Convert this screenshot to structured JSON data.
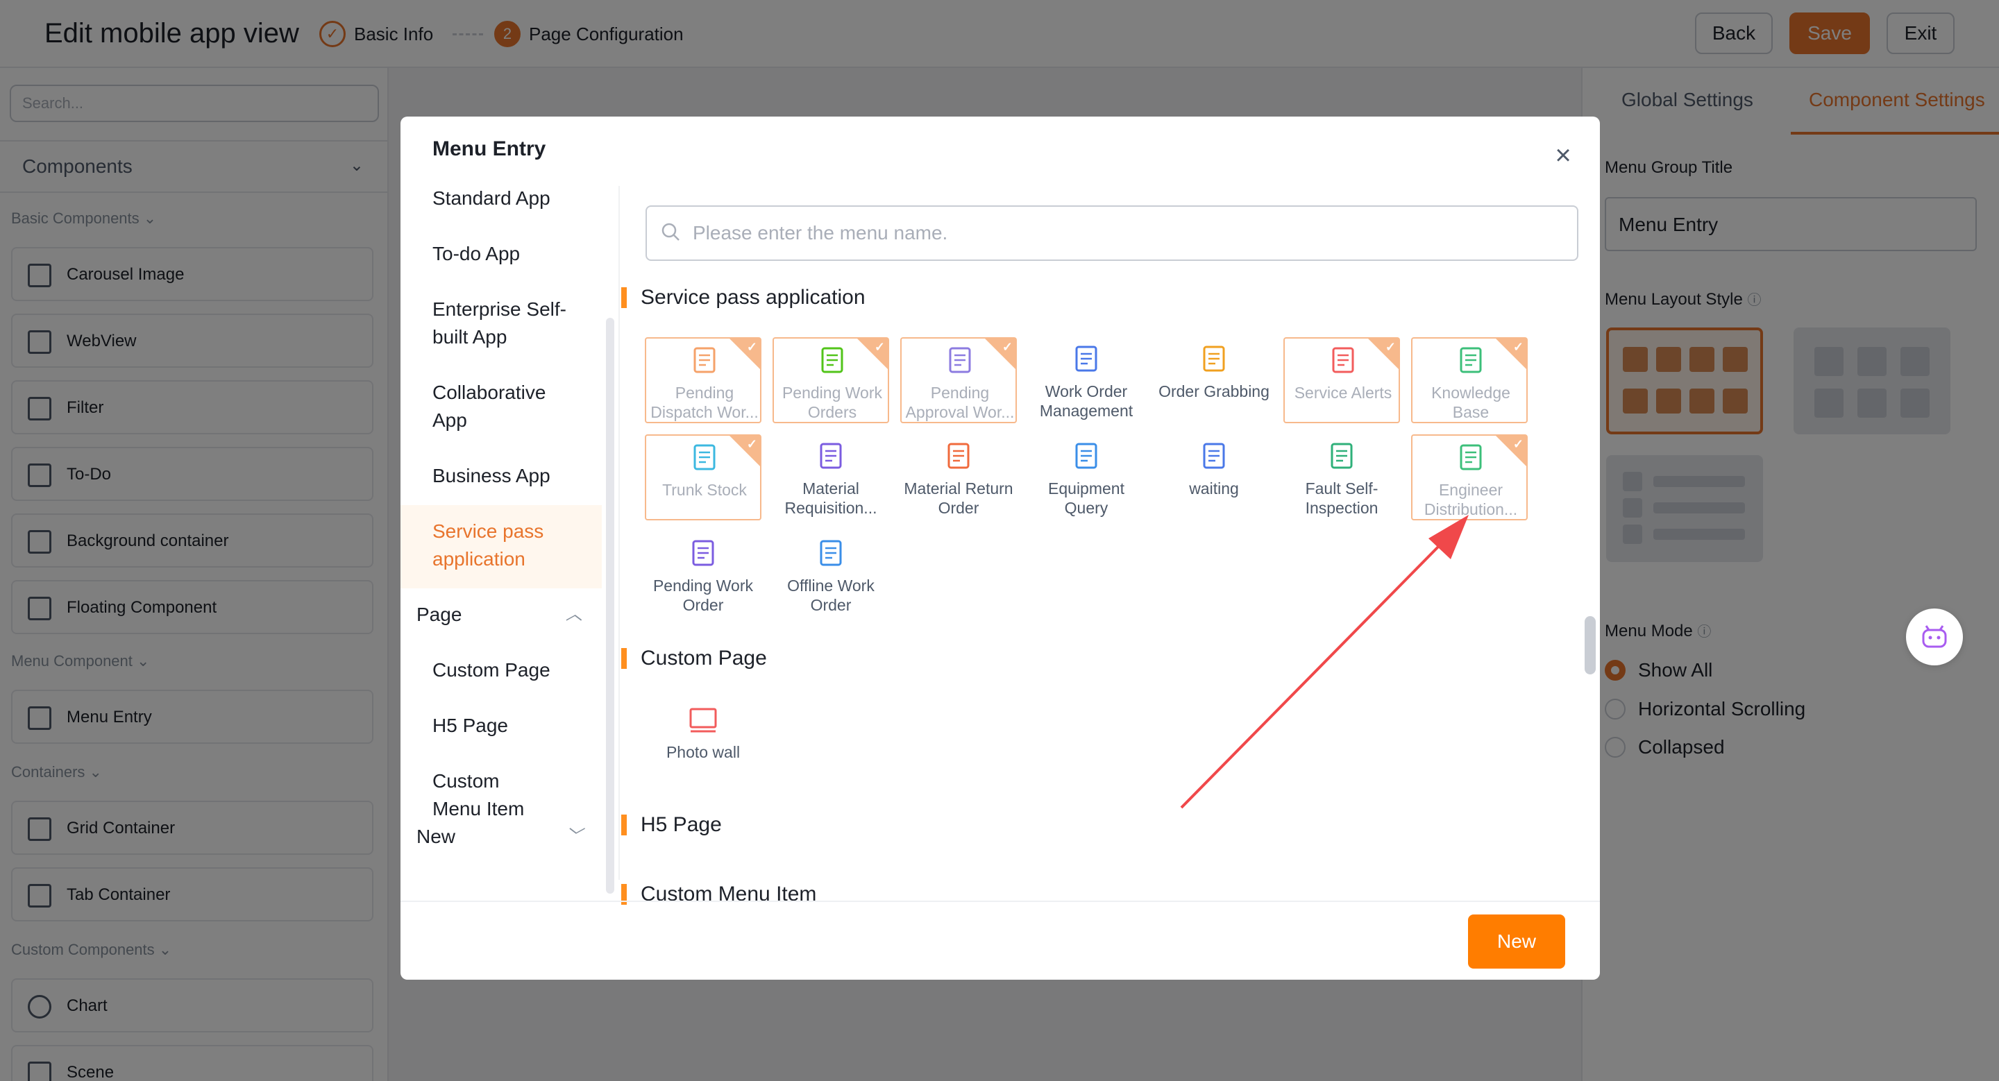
{
  "header": {
    "title": "Edit mobile app view",
    "steps": [
      {
        "label": "Basic Info"
      },
      {
        "number": "2",
        "label": "Page Configuration"
      }
    ],
    "buttons": {
      "back": "Back",
      "save": "Save",
      "exit": "Exit"
    }
  },
  "left_panel": {
    "search_placeholder": "Search...",
    "components_title": "Components",
    "groups": [
      {
        "label": "Basic Components",
        "items": [
          "Carousel Image",
          "WebView",
          "Filter",
          "To-Do",
          "Background container",
          "Floating Component"
        ]
      },
      {
        "label": "Menu Component",
        "items": [
          "Menu Entry"
        ]
      },
      {
        "label": "Containers",
        "items": [
          "Grid Container",
          "Tab Container"
        ]
      },
      {
        "label": "Custom Components",
        "items": [
          "Chart",
          "Scene"
        ]
      }
    ]
  },
  "right_panel": {
    "tabs": [
      "Global Settings",
      "Component Settings"
    ],
    "active_tab": "Component Settings",
    "menu_group_title_label": "Menu Group Title",
    "menu_group_title_value": "Menu Entry",
    "menu_layout_style_label": "Menu Layout Style",
    "menu_mode_label": "Menu Mode",
    "menu_mode_options": [
      "Show All",
      "Horizontal Scrolling",
      "Collapsed"
    ],
    "menu_mode_selected": "Show All"
  },
  "modal": {
    "title": "Menu Entry",
    "search_placeholder": "Please enter the menu name.",
    "nav": {
      "standard_app": "Standard App",
      "todo_app": "To-do App",
      "enterprise_app": "Enterprise Self-built App",
      "collaborative_app": "Collaborative App",
      "business_app": "Business App",
      "service_pass_app": "Service pass application",
      "page": "Page",
      "custom_page": "Custom Page",
      "h5_page": "H5 Page",
      "custom_menu_item": "Custom Menu Item",
      "new": "New"
    },
    "sections": {
      "service_pass": {
        "title": "Service pass application",
        "items": [
          {
            "label": "Pending Dispatch Wor...",
            "selected": true,
            "icon": "dispatch-doc-icon",
            "color": "#f5a26a"
          },
          {
            "label": "Pending Work Orders",
            "selected": true,
            "icon": "wrench-icon",
            "color": "#52c41a"
          },
          {
            "label": "Pending Approval Wor...",
            "selected": true,
            "icon": "approval-stamp-icon",
            "color": "#8c7be0"
          },
          {
            "label": "Work Order Management",
            "selected": false,
            "icon": "list-doc-icon",
            "color": "#4a78e8"
          },
          {
            "label": "Order Grabbing",
            "selected": false,
            "icon": "grab-doc-icon",
            "color": "#f0a020"
          },
          {
            "label": "Service Alerts",
            "selected": true,
            "icon": "alert-circle-icon",
            "color": "#f25c5c"
          },
          {
            "label": "Knowledge Base",
            "selected": true,
            "icon": "book-icon",
            "color": "#3cbf7a"
          },
          {
            "label": "Trunk Stock",
            "selected": true,
            "icon": "warehouse-icon",
            "color": "#3cb8e0"
          },
          {
            "label": "Material Requisition...",
            "selected": false,
            "icon": "material-box-icon",
            "color": "#7b5ce0"
          },
          {
            "label": "Material Return Order",
            "selected": false,
            "icon": "return-doc-icon",
            "color": "#f06a3c"
          },
          {
            "label": "Equipment Query",
            "selected": false,
            "icon": "equipment-search-icon",
            "color": "#3a8ee8"
          },
          {
            "label": "waiting",
            "selected": false,
            "icon": "door-icon",
            "color": "#4a78e8"
          },
          {
            "label": "Fault Self-Inspection",
            "selected": false,
            "icon": "inspection-icon",
            "color": "#2fb07a"
          },
          {
            "label": "Engineer Distribution...",
            "selected": true,
            "icon": "engineer-location-icon",
            "color": "#3cbf7a"
          },
          {
            "label": "Pending Work Order",
            "selected": false,
            "icon": "pending-clock-doc-icon",
            "color": "#7b5ce0"
          },
          {
            "label": "Offline Work Order",
            "selected": false,
            "icon": "wifi-off-icon",
            "color": "#3a8ee8"
          }
        ]
      },
      "custom_page": {
        "title": "Custom Page",
        "items": [
          {
            "label": "Photo wall",
            "icon": "photo-wall-icon",
            "color": "#f25c5c"
          }
        ]
      },
      "h5_page": {
        "title": "H5 Page"
      },
      "custom_menu_item": {
        "title": "Custom Menu Item"
      }
    },
    "footer_new_button": "New"
  },
  "colors": {
    "accent": "#e8742c",
    "primary_button": "#ff7d00",
    "annotation_arrow": "#f0484a"
  }
}
